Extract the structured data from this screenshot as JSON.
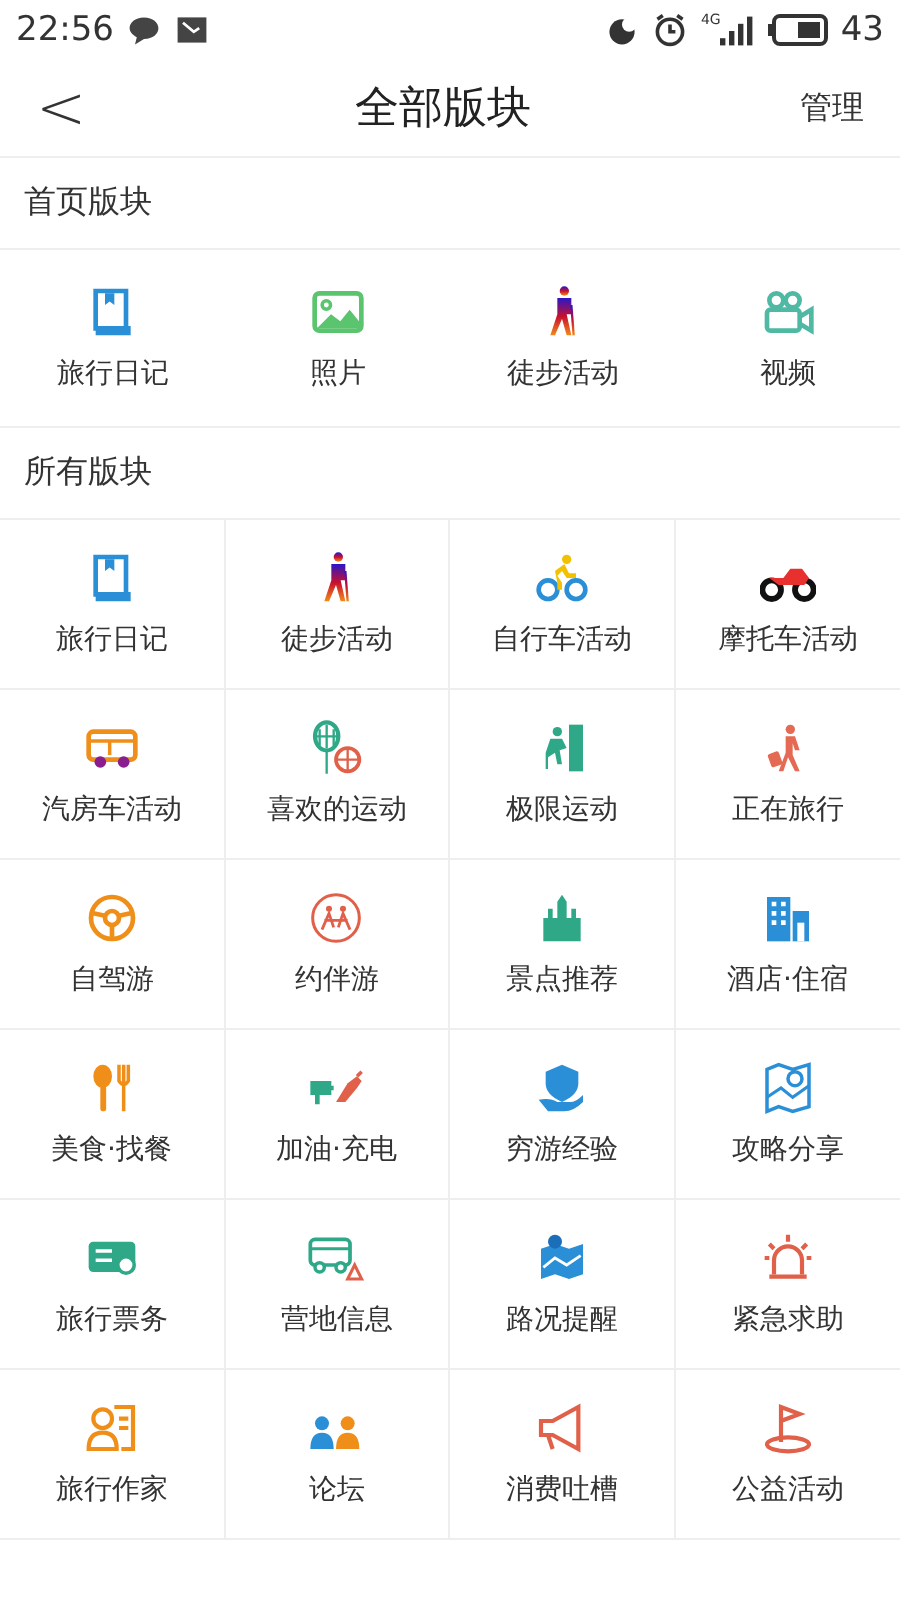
{
  "status_bar": {
    "time": "22:56",
    "network": "4G",
    "battery": "43"
  },
  "header": {
    "back": "<",
    "title": "全部版块",
    "action": "管理"
  },
  "home_section": {
    "title": "首页版块",
    "items": [
      "旅行日记",
      "照片",
      "徒步活动",
      "视频"
    ]
  },
  "all_section": {
    "title": "所有版块",
    "items": [
      "旅行日记",
      "徒步活动",
      "自行车活动",
      "摩托车活动",
      "汽房车活动",
      "喜欢的运动",
      "极限运动",
      "正在旅行",
      "自驾游",
      "约伴游",
      "景点推荐",
      "酒店·住宿",
      "美食·找餐",
      "加油·充电",
      "穷游经验",
      "攻略分享",
      "旅行票务",
      "营地信息",
      "路况提醒",
      "紧急求助",
      "旅行作家",
      "论坛",
      "消费吐槽",
      "公益活动"
    ]
  }
}
